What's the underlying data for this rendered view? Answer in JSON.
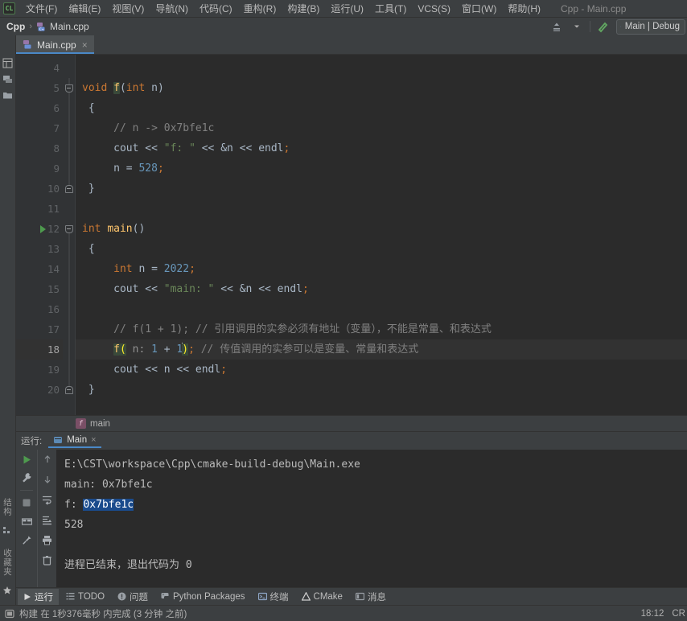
{
  "menubar": {
    "logo_text": "CL",
    "items": [
      {
        "label": "文件(F)"
      },
      {
        "label": "编辑(E)"
      },
      {
        "label": "视图(V)"
      },
      {
        "label": "导航(N)"
      },
      {
        "label": "代码(C)"
      },
      {
        "label": "重构(R)"
      },
      {
        "label": "构建(B)"
      },
      {
        "label": "运行(U)"
      },
      {
        "label": "工具(T)"
      },
      {
        "label": "VCS(S)"
      },
      {
        "label": "窗口(W)"
      },
      {
        "label": "帮助(H)"
      }
    ],
    "window_title": "Cpp - Main.cpp"
  },
  "navbar": {
    "crumbs": [
      {
        "label": "Cpp"
      },
      {
        "label": "Main.cpp"
      }
    ],
    "separator": "›",
    "run_config": "Main | Debug"
  },
  "editor_tabs": [
    {
      "label": "Main.cpp",
      "close": "×"
    }
  ],
  "left_stripe": {
    "tabs": [
      {
        "label": "结构"
      },
      {
        "label": "收藏夹"
      }
    ]
  },
  "editor": {
    "lines": [
      {
        "num": "4",
        "current": false,
        "fold": "none",
        "run": false
      },
      {
        "num": "5",
        "current": false,
        "fold": "top",
        "run": false
      },
      {
        "num": "6",
        "current": false,
        "fold": "none",
        "run": false
      },
      {
        "num": "7",
        "current": false,
        "fold": "none",
        "run": false
      },
      {
        "num": "8",
        "current": false,
        "fold": "none",
        "run": false
      },
      {
        "num": "9",
        "current": false,
        "fold": "none",
        "run": false
      },
      {
        "num": "10",
        "current": false,
        "fold": "bot",
        "run": false
      },
      {
        "num": "11",
        "current": false,
        "fold": "none",
        "run": false
      },
      {
        "num": "12",
        "current": false,
        "fold": "top",
        "run": true
      },
      {
        "num": "13",
        "current": false,
        "fold": "none",
        "run": false
      },
      {
        "num": "14",
        "current": false,
        "fold": "none",
        "run": false
      },
      {
        "num": "15",
        "current": false,
        "fold": "none",
        "run": false
      },
      {
        "num": "16",
        "current": false,
        "fold": "none",
        "run": false
      },
      {
        "num": "17",
        "current": false,
        "fold": "none",
        "run": false
      },
      {
        "num": "18",
        "current": true,
        "fold": "none",
        "run": false
      },
      {
        "num": "19",
        "current": false,
        "fold": "none",
        "run": false
      },
      {
        "num": "20",
        "current": false,
        "fold": "bot",
        "run": false
      }
    ],
    "code": {
      "l4": "",
      "l5": "void f(int n)",
      "l6": "{",
      "l7": "    // n -> 0x7bfe1c",
      "l8": "    cout << \"f: \" << &n << endl;",
      "l9": "    n = 528;",
      "l10": "}",
      "l11": "",
      "l12": "int main()",
      "l13": "{",
      "l14": "    int n = 2022;",
      "l15": "    cout << \"main: \" << &n << endl;",
      "l16": "",
      "l17": "    // f(1 + 1); // 引用调用的实参必须有地址（变量），不能是常量、和表达式",
      "l18": "    f( n: 1 + 1); // 传值调用的实参可以是变量、常量和表达式",
      "l19": "    cout << n << endl;",
      "l20": "}"
    },
    "tokens": {
      "kw_void": "void",
      "fn_f": "f",
      "kw_int": "int",
      "paren_open": "(",
      "paren_close": ")",
      "n": "n",
      "brace_open": "{",
      "brace_close": "}",
      "cmt7": "// n -> 0x7bfe1c",
      "cout": "cout",
      "shift": "<<",
      "str_f": "\"f: \"",
      "amp_n": "&n",
      "endl": "endl",
      "semi": ";",
      "assign": "=",
      "num528": "528",
      "kw_main": "main",
      "num2022": "2022",
      "str_main": "\"main: \"",
      "cmt17": "// f(1 + 1); // 引用调用的实参必须有地址（变量），不能是常量、和表达式",
      "cmt18": "// 传值调用的实参可以是变量、常量和表达式",
      "hint_n": "n:",
      "num1": "1",
      "plus": "+"
    },
    "breadcrumb": {
      "badge": "f",
      "label": "main"
    }
  },
  "run_panel": {
    "title": "运行:",
    "tab_label": "Main",
    "tab_close": "×",
    "console_lines": [
      {
        "text": "E:\\CST\\workspace\\Cpp\\cmake-build-debug\\Main.exe",
        "selected": null
      },
      {
        "text": "main: 0x7bfe1c",
        "selected": null
      },
      {
        "text": "f: ",
        "selected": "0x7bfe1c"
      },
      {
        "text": "528",
        "selected": null
      },
      {
        "text": "",
        "selected": null
      },
      {
        "text": "进程已结束，退出代码为 0",
        "selected": null
      }
    ]
  },
  "bottom_bar": {
    "items": [
      {
        "label": "运行",
        "icon": "play-icon",
        "active": true
      },
      {
        "label": "TODO",
        "icon": "todo-icon",
        "active": false
      },
      {
        "label": "问题",
        "icon": "problems-icon",
        "active": false
      },
      {
        "label": "Python Packages",
        "icon": "python-icon",
        "active": false
      },
      {
        "label": "终端",
        "icon": "terminal-icon",
        "active": false
      },
      {
        "label": "CMake",
        "icon": "cmake-icon",
        "active": false
      },
      {
        "label": "消息",
        "icon": "messages-icon",
        "active": false
      }
    ]
  },
  "status_bar": {
    "message": "构建 在 1秒376毫秒 内完成 (3 分钟 之前)",
    "time": "18:12",
    "line_sep": "CR"
  },
  "colors": {
    "accent": "#4a88c7",
    "run_green": "#4e9a4e",
    "selection_blue": "#1a4b8c",
    "keyword": "#cc7832",
    "function": "#ffc66d",
    "number": "#6897bb",
    "string": "#6a8759",
    "comment": "#808080",
    "editor_bg": "#2b2b2b",
    "panel_bg": "#3c3f41"
  }
}
